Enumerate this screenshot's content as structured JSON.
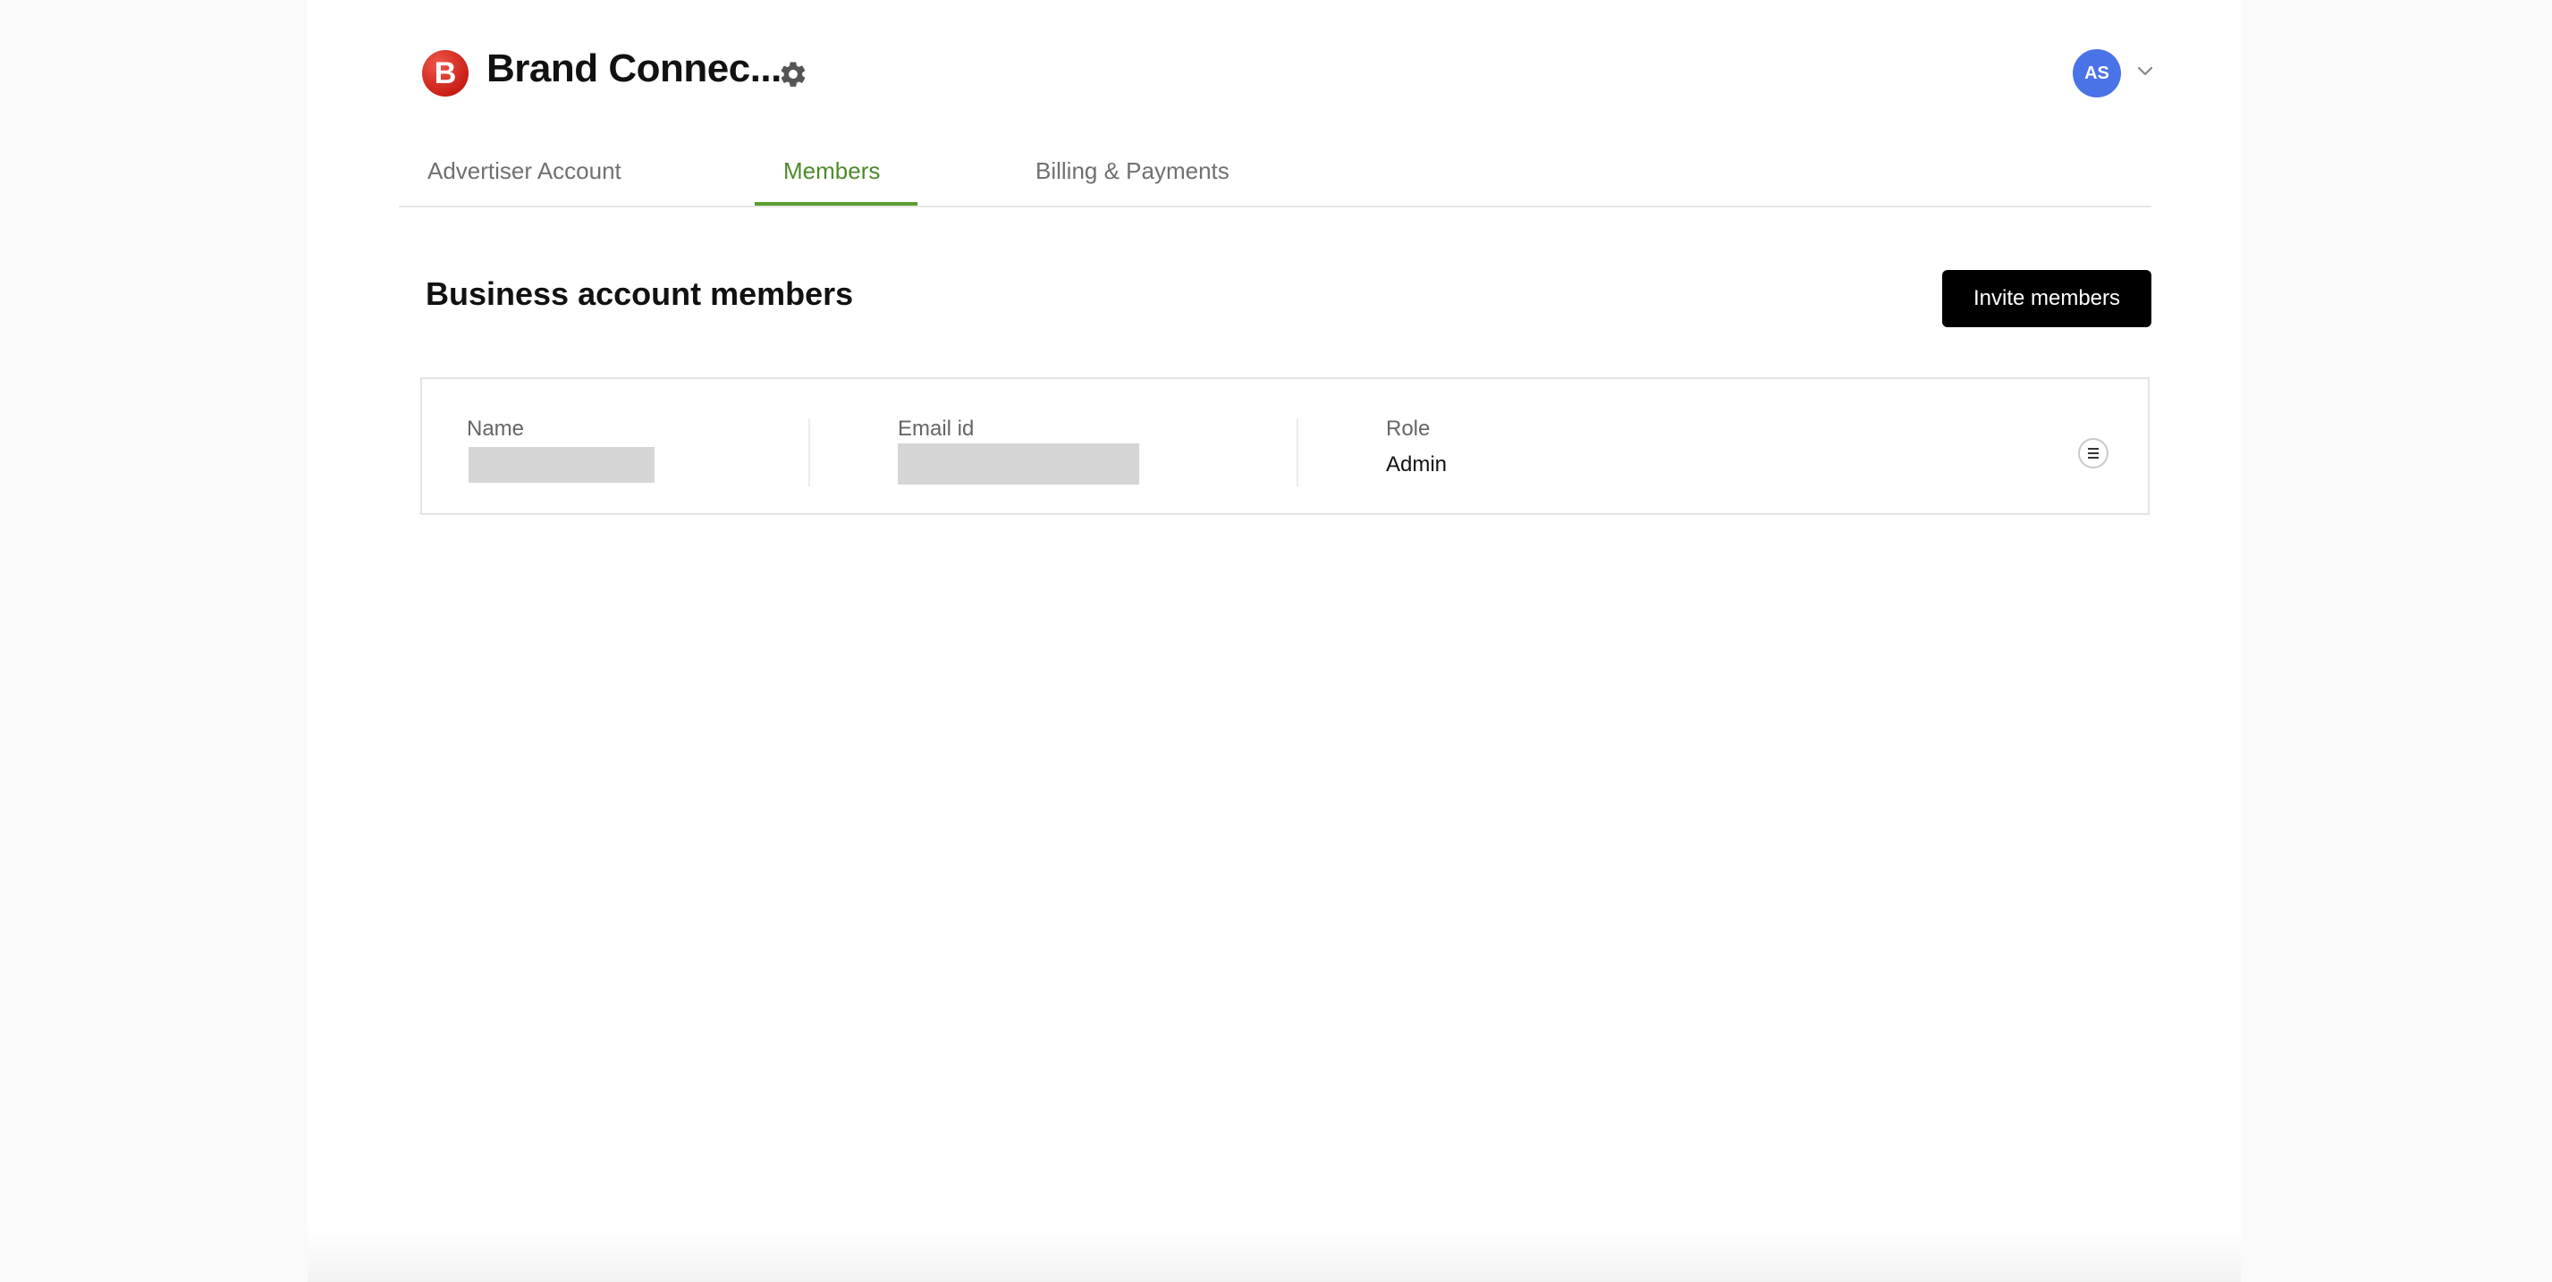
{
  "header": {
    "brand_logo_letter": "B",
    "brand_title": "Brand Connec...",
    "settings_icon": "gear-icon",
    "avatar_initials": "AS",
    "avatar_menu_icon": "chevron-down-icon"
  },
  "tabs": [
    {
      "label": "Advertiser Account",
      "active": false
    },
    {
      "label": "Members",
      "active": true
    },
    {
      "label": "Billing & Payments",
      "active": false
    }
  ],
  "section": {
    "title": "Business account members",
    "invite_label": "Invite members"
  },
  "members": {
    "columns": [
      "Name",
      "Email id",
      "Role"
    ],
    "rows": [
      {
        "name": "",
        "email": "",
        "role": "Admin"
      }
    ],
    "row_menu_icon": "menu-icon"
  },
  "colors": {
    "active_tab": "#4e8a2a",
    "brand_red": "#d42a1f",
    "avatar_blue": "#4a73e8",
    "button_black": "#000000"
  }
}
